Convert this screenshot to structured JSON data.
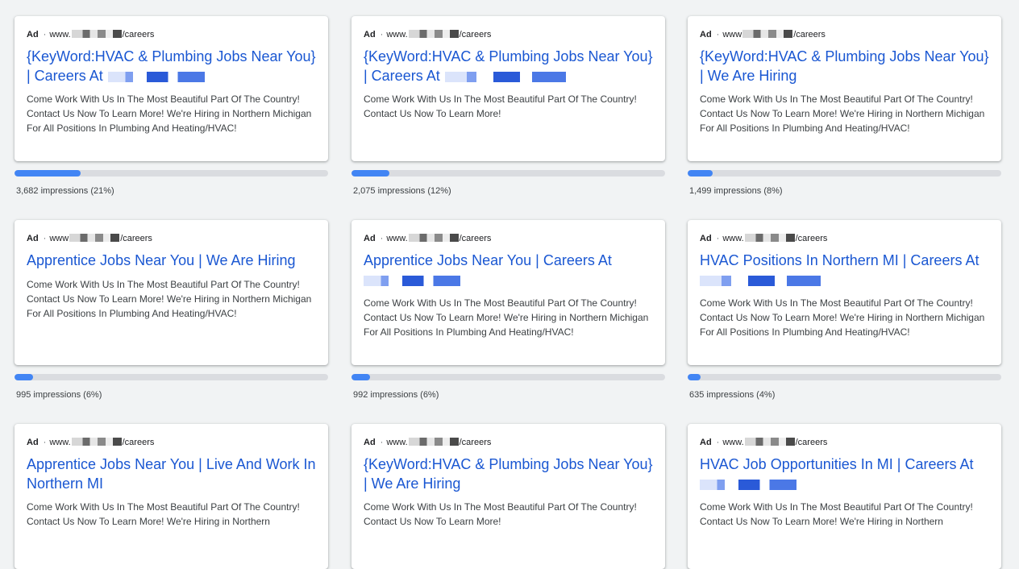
{
  "cards": [
    {
      "ad_label": "Ad",
      "url_prefix": "www.",
      "url_suffix": "/careers",
      "headline": "{KeyWord:HVAC & Plumbing Jobs Near You} | Careers At",
      "description": "Come Work With Us In The Most Beautiful Part Of The Country! Contact Us Now To Learn More! We're Hiring in Northern Michigan For All Positions In Plumbing And Heating/HVAC!",
      "impressions": "3,682 impressions (21%)",
      "share": 0.21
    },
    {
      "ad_label": "Ad",
      "url_prefix": "www.",
      "url_suffix": "/careers",
      "headline": "{KeyWord:HVAC & Plumbing Jobs Near You} | Careers At",
      "description": "Come Work With Us In The Most Beautiful Part Of The Country! Contact Us Now To Learn More!",
      "impressions": "2,075 impressions (12%)",
      "share": 0.12
    },
    {
      "ad_label": "Ad",
      "url_prefix": "www",
      "url_suffix": "/careers",
      "headline": "{KeyWord:HVAC & Plumbing Jobs Near You} | We Are Hiring",
      "description": "Come Work With Us In The Most Beautiful Part Of The Country! Contact Us Now To Learn More! We're Hiring in Northern Michigan For All Positions In Plumbing And Heating/HVAC!",
      "impressions": "1,499 impressions (8%)",
      "share": 0.08
    },
    {
      "ad_label": "Ad",
      "url_prefix": "www",
      "url_suffix": "/careers",
      "headline": "Apprentice Jobs Near You | We Are Hiring",
      "description": "Come Work With Us In The Most Beautiful Part Of The Country! Contact Us Now To Learn More! We're Hiring in Northern Michigan For All Positions In Plumbing And Heating/HVAC!",
      "impressions": "995 impressions (6%)",
      "share": 0.06
    },
    {
      "ad_label": "Ad",
      "url_prefix": "www.",
      "url_suffix": "/careers",
      "headline": "Apprentice Jobs Near You | Careers At",
      "description": "Come Work With Us In The Most Beautiful Part Of The Country! Contact Us Now To Learn More! We're Hiring in Northern Michigan For All Positions In Plumbing And Heating/HVAC!",
      "impressions": "992 impressions (6%)",
      "share": 0.06
    },
    {
      "ad_label": "Ad",
      "url_prefix": "www.",
      "url_suffix": "/careers",
      "headline": "HVAC Positions In Northern MI | Careers At",
      "description": "Come Work With Us In The Most Beautiful Part Of The Country! Contact Us Now To Learn More! We're Hiring in Northern Michigan For All Positions In Plumbing And Heating/HVAC!",
      "impressions": "635 impressions (4%)",
      "share": 0.04
    },
    {
      "ad_label": "Ad",
      "url_prefix": "www.",
      "url_suffix": "/careers",
      "headline": "Apprentice Jobs Near You | Live And Work In Northern MI",
      "description": "Come Work With Us In The Most Beautiful Part Of The Country! Contact Us Now To Learn More! We're Hiring in Northern",
      "impressions": "",
      "share": null
    },
    {
      "ad_label": "Ad",
      "url_prefix": "www.",
      "url_suffix": "/careers",
      "headline": "{KeyWord:HVAC & Plumbing Jobs Near You} | We Are Hiring",
      "description": "Come Work With Us In The Most Beautiful Part Of The Country! Contact Us Now To Learn More!",
      "impressions": "",
      "share": null
    },
    {
      "ad_label": "Ad",
      "url_prefix": "www.",
      "url_suffix": "/careers",
      "headline": "HVAC Job Opportunities In MI | Careers At",
      "description": "Come Work With Us In The Most Beautiful Part Of The Country! Contact Us Now To Learn More! We're Hiring in Northern",
      "impressions": "",
      "share": null
    }
  ],
  "colors": {
    "background": "#f1f3f4",
    "headline": "#1a57d2",
    "bar_fill": "#4285f4",
    "bar_track": "#dadce0"
  }
}
